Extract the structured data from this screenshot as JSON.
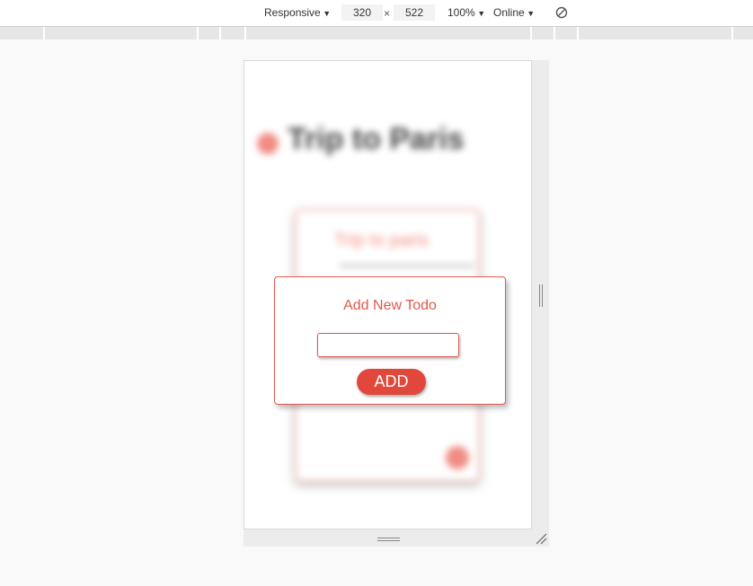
{
  "toolbar": {
    "device": "Responsive",
    "width": "320",
    "times": "×",
    "height": "522",
    "zoom": "100%",
    "throttle": "Online",
    "rotate_icon": "rotate-icon"
  },
  "background_app": {
    "title": "Trip to Paris",
    "card_title": "Trip to paris"
  },
  "modal": {
    "title": "Add New Todo",
    "input_value": "",
    "input_placeholder": "",
    "add_label": "ADD"
  },
  "colors": {
    "accent": "#e2473b",
    "accent_border": "#e2584c",
    "blurred_accent": "#f08c84"
  }
}
